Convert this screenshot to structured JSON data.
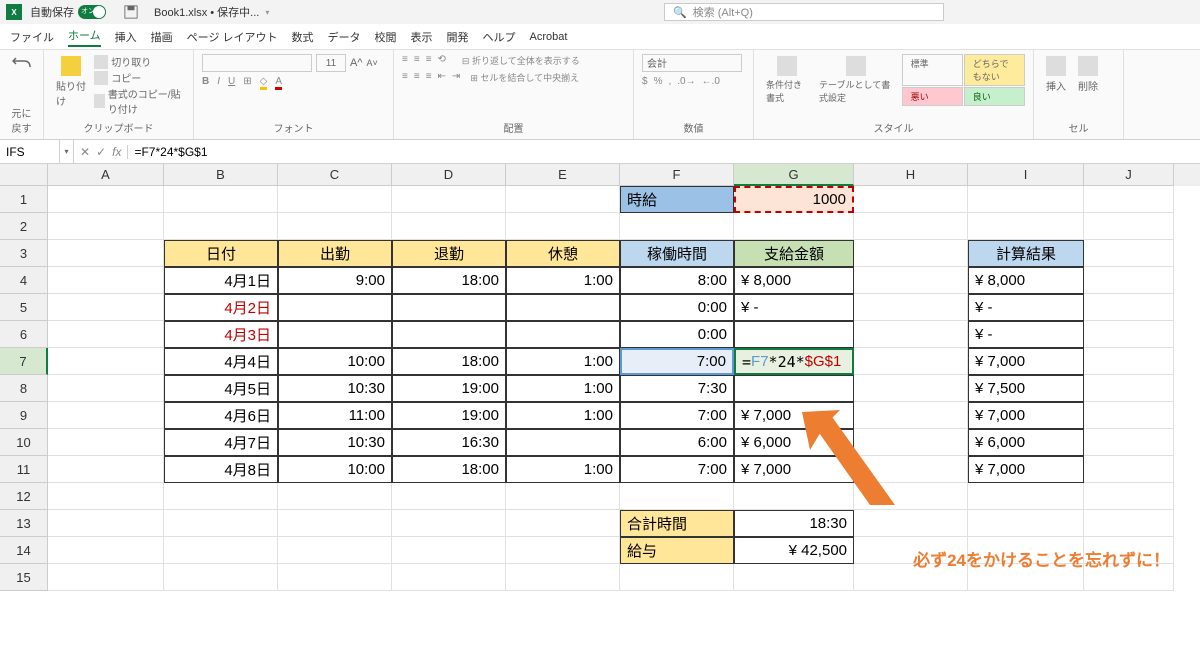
{
  "titlebar": {
    "autosave_label": "自動保存",
    "autosave_state": "オン",
    "filename": "Book1.xlsx • 保存中...",
    "search_placeholder": "検索 (Alt+Q)"
  },
  "menubar": {
    "items": [
      "ファイル",
      "ホーム",
      "挿入",
      "描画",
      "ページ レイアウト",
      "数式",
      "データ",
      "校閲",
      "表示",
      "開発",
      "ヘルプ",
      "Acrobat"
    ],
    "active_index": 1
  },
  "ribbon": {
    "undo": "元に戻す",
    "clipboard": {
      "label": "クリップボード",
      "paste": "貼り付け",
      "cut": "切り取り",
      "copy": "コピー",
      "format_painter": "書式のコピー/貼り付け"
    },
    "font": {
      "label": "フォント",
      "size": "11"
    },
    "alignment": {
      "label": "配置",
      "wrap": "折り返して全体を表示する",
      "merge": "セルを結合して中央揃え"
    },
    "number": {
      "label": "数値",
      "format": "会計"
    },
    "styles": {
      "label": "スタイル",
      "conditional": "条件付き書式",
      "table": "テーブルとして書式設定",
      "normal": "標準",
      "neutral": "どちらでもない",
      "bad": "悪い",
      "good": "良い"
    },
    "cells": {
      "label": "セル",
      "insert": "挿入",
      "delete": "削除"
    }
  },
  "formula_bar": {
    "name": "IFS",
    "formula": "=F7*24*$G$1"
  },
  "columns": [
    "A",
    "B",
    "C",
    "D",
    "E",
    "F",
    "G",
    "H",
    "I",
    "J"
  ],
  "cells": {
    "F1": "時給",
    "G1": "1000",
    "headers": {
      "B3": "日付",
      "C3": "出勤",
      "D3": "退勤",
      "E3": "休憩",
      "F3": "稼働時間",
      "G3": "支給金額",
      "I3": "計算結果"
    },
    "rows": [
      {
        "r": 4,
        "B": "4月1日",
        "C": "9:00",
        "D": "18:00",
        "E": "1:00",
        "F": "8:00",
        "G": "¥   8,000",
        "I": "¥   8,000"
      },
      {
        "r": 5,
        "B": "4月2日",
        "C": "",
        "D": "",
        "E": "",
        "F": "0:00",
        "G": "¥          -",
        "I": "¥          -",
        "red": true
      },
      {
        "r": 6,
        "B": "4月3日",
        "C": "",
        "D": "",
        "E": "",
        "F": "0:00",
        "G": "",
        "I": "¥          -",
        "red": true
      },
      {
        "r": 7,
        "B": "4月4日",
        "C": "10:00",
        "D": "18:00",
        "E": "1:00",
        "F": "7:00",
        "G_formula": {
          "pre": "=",
          "ref1": "F7",
          "mid": "*24*",
          "ref2": "$G$1"
        },
        "I": "¥   7,000"
      },
      {
        "r": 8,
        "B": "4月5日",
        "C": "10:30",
        "D": "19:00",
        "E": "1:00",
        "F": "7:30",
        "G": "",
        "I": "¥   7,500"
      },
      {
        "r": 9,
        "B": "4月6日",
        "C": "11:00",
        "D": "19:00",
        "E": "1:00",
        "F": "7:00",
        "G": "¥   7,000",
        "I": "¥   7,000"
      },
      {
        "r": 10,
        "B": "4月7日",
        "C": "10:30",
        "D": "16:30",
        "E": "",
        "F": "6:00",
        "G": "¥   6,000",
        "I": "¥   6,000"
      },
      {
        "r": 11,
        "B": "4月8日",
        "C": "10:00",
        "D": "18:00",
        "E": "1:00",
        "F": "7:00",
        "G": "¥   7,000",
        "I": "¥   7,000"
      }
    ],
    "F13": "合計時間",
    "G13": "18:30",
    "F14": "給与",
    "G14": "¥ 42,500"
  },
  "annotation": "必ず24をかけることを忘れずに！",
  "selected_col": "G",
  "selected_row": 7
}
